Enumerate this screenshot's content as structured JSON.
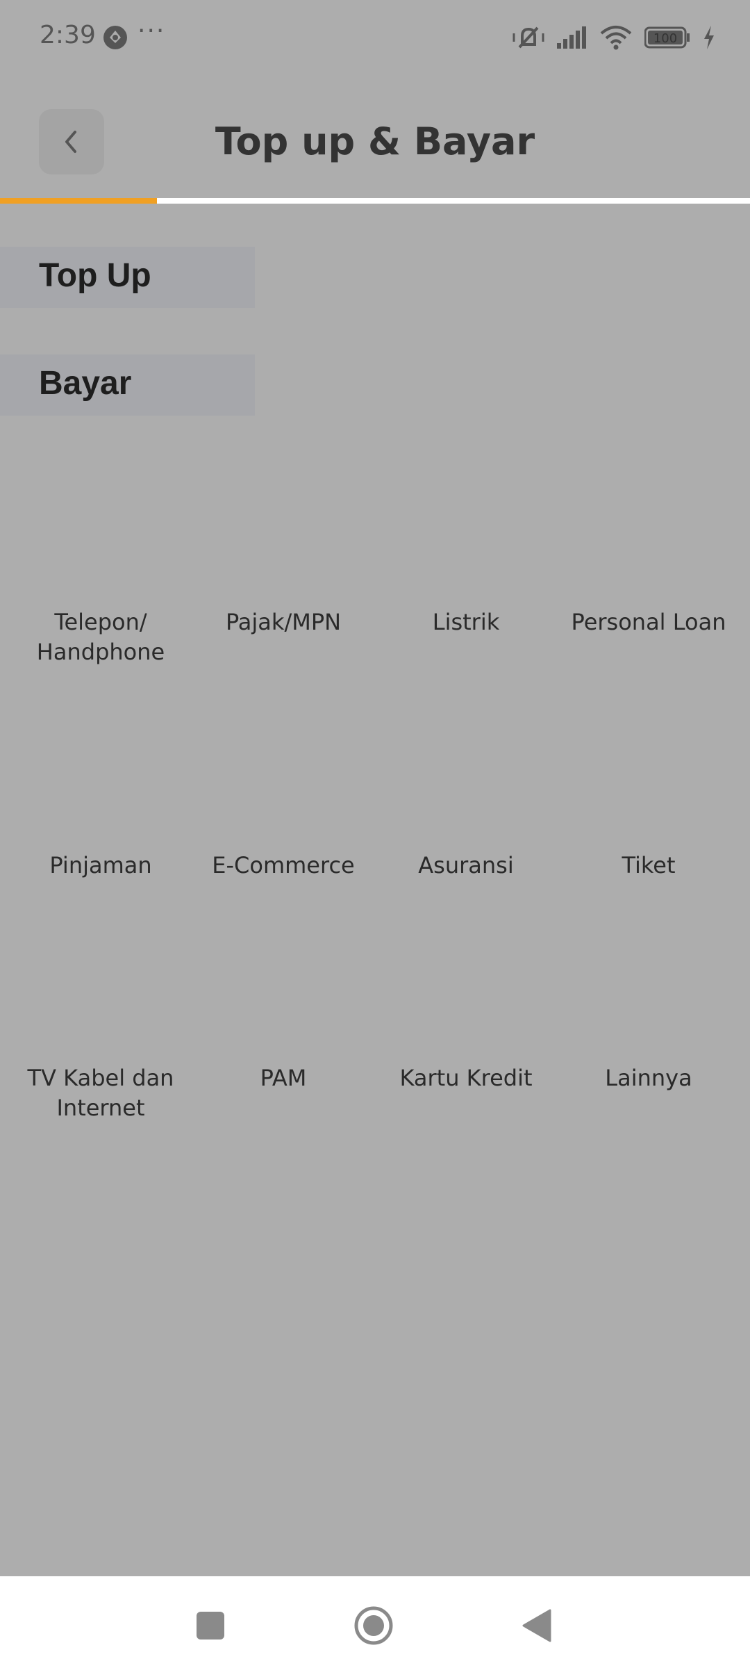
{
  "status_bar": {
    "time": "2:39",
    "dots": "···",
    "battery": "100"
  },
  "header": {
    "title": "Top up & Bayar"
  },
  "progress": {
    "fraction": 0.2
  },
  "categories": {
    "top_up": "Top Up",
    "bayar": "Bayar"
  },
  "services": [
    {
      "label": "Telepon/\nHandphone"
    },
    {
      "label": "Pajak/MPN"
    },
    {
      "label": "Listrik"
    },
    {
      "label": "Personal Loan"
    },
    {
      "label": "Pinjaman"
    },
    {
      "label": "E-Commerce"
    },
    {
      "label": "Asuransi"
    },
    {
      "label": "Tiket"
    },
    {
      "label": "TV Kabel dan\nInternet"
    },
    {
      "label": "PAM"
    },
    {
      "label": "Kartu Kredit"
    },
    {
      "label": "Lainnya"
    }
  ],
  "colors": {
    "accent": "#f0a023",
    "background": "#adadad"
  }
}
